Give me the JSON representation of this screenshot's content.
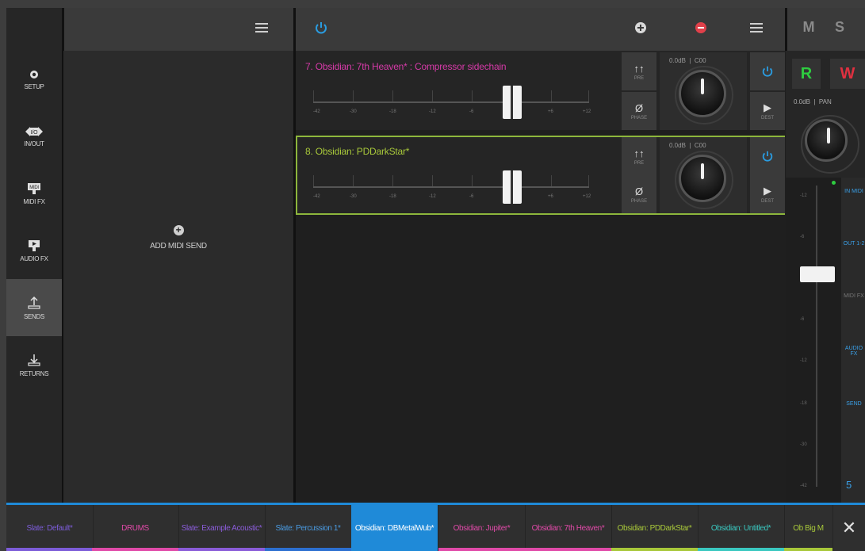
{
  "sidebar": {
    "items": [
      {
        "label": "SETUP",
        "icon": "gear-icon"
      },
      {
        "label": "IN/OUT",
        "icon": "io-icon"
      },
      {
        "label": "MIDI FX",
        "icon": "midi-fx-icon"
      },
      {
        "label": "AUDIO FX",
        "icon": "audio-fx-icon"
      },
      {
        "label": "SENDS",
        "icon": "sends-icon",
        "active": true
      },
      {
        "label": "RETURNS",
        "icon": "returns-icon"
      }
    ]
  },
  "midi_sends": {
    "add_label": "ADD MIDI SEND"
  },
  "sends": [
    {
      "title": "7. Obsidian: 7th Heaven* : Compressor sidechain",
      "color": "#d63aa8",
      "gain": "0.0dB",
      "pan": "C00",
      "pre_label": "PRE",
      "phase_label": "PHASE",
      "dest_label": "DEST",
      "selected": false
    },
    {
      "title": "8. Obsidian: PDDarkStar*",
      "color": "#a8c83a",
      "gain": "0.0dB",
      "pan": "C00",
      "pre_label": "PRE",
      "phase_label": "PHASE",
      "dest_label": "DEST",
      "selected": true
    }
  ],
  "fader_ticks": [
    "-42",
    "-30",
    "-18",
    "-12",
    "-6",
    "0",
    "+6",
    "+12"
  ],
  "strip": {
    "m_label": "M",
    "s_label": "S",
    "r_label": "R",
    "w_label": "W",
    "gain": "0.0dB",
    "pan_label": "PAN",
    "meter_ticks": [
      "-12",
      "-6",
      "0",
      "-6",
      "-12",
      "-18",
      "-30",
      "-42"
    ],
    "side_labels": [
      "IN MIDI",
      "OUT 1-2",
      "MIDI FX",
      "AUDIO FX",
      "SEND"
    ],
    "number": "5"
  },
  "tracks": [
    {
      "label": "Slate: Default*",
      "color": "#7c5cd8",
      "bar": "#7c5cd8"
    },
    {
      "label": "DRUMS",
      "color": "#e04aa8",
      "bar": "#e04aa8"
    },
    {
      "label": "Slate: Example Acoustic*",
      "color": "#8a5cd8",
      "bar": "#8a5cd8"
    },
    {
      "label": "Slate: Percussion 1*",
      "color": "#4a9ae0",
      "bar": "#2c6fd0"
    },
    {
      "label": "Obsidian: DBMetalWub*",
      "color": "#ffffff",
      "bar": "#1f8ad8",
      "active": true
    },
    {
      "label": "Obsidian: Jupiter*",
      "color": "#e04aa8",
      "bar": "#e04aa8"
    },
    {
      "label": "Obsidian: 7th Heaven*",
      "color": "#e04aa8",
      "bar": "#e04aa8"
    },
    {
      "label": "Obsidian: PDDarkStar*",
      "color": "#a8c83a",
      "bar": "#a8c83a"
    },
    {
      "label": "Obsidian: Untitled*",
      "color": "#3ac8c0",
      "bar": "#3ac8c0"
    },
    {
      "label": "Ob Big M",
      "color": "#a8c83a",
      "bar": "#a8c83a"
    }
  ],
  "colors": {
    "accent": "#1f8ad8",
    "power": "#2a9ce0",
    "remove": "#e0404a",
    "record": "#2ecc40",
    "write": "#e03040"
  }
}
